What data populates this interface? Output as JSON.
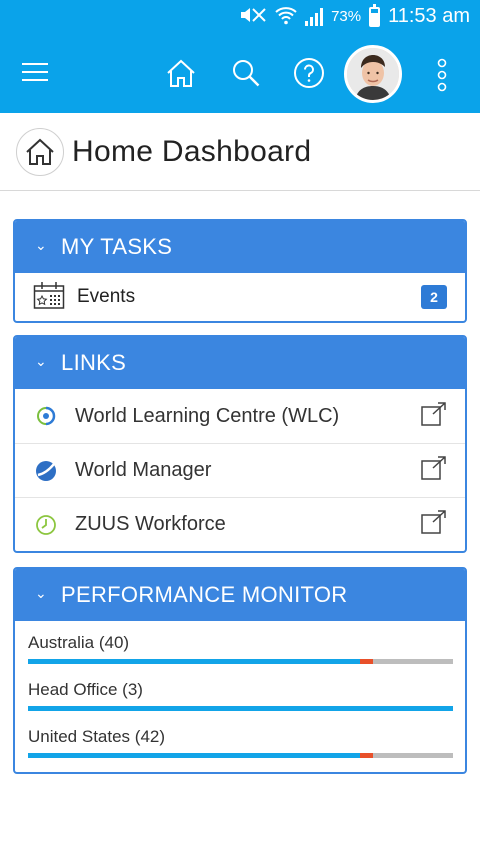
{
  "status_bar": {
    "battery": "73%",
    "time": "11:53 am"
  },
  "app_bar": {
    "icons": [
      "hamburger-menu-icon",
      "home-icon",
      "search-icon",
      "help-icon",
      "more-vertical-icon"
    ],
    "accent_color": "#0aa3ea"
  },
  "page": {
    "title": "Home Dashboard"
  },
  "my_tasks": {
    "header": "MY TASKS",
    "items": [
      {
        "label": "Events",
        "count": "2"
      }
    ]
  },
  "links": {
    "header": "LINKS",
    "items": [
      {
        "label": "World Learning Centre (WLC)",
        "icon": "wlc-logo-icon"
      },
      {
        "label": "World Manager",
        "icon": "world-manager-logo-icon"
      },
      {
        "label": "ZUUS Workforce",
        "icon": "zuus-clock-icon"
      }
    ]
  },
  "performance": {
    "header": "PERFORMANCE MONITOR",
    "items": [
      {
        "label": "Australia (40)",
        "progress": 0.78,
        "marker_width": 0.03
      },
      {
        "label": "Head Office (3)",
        "progress": 1.0,
        "marker_width": 0
      },
      {
        "label": "United States (42)",
        "progress": 0.78,
        "marker_width": 0.03
      }
    ],
    "colors": {
      "fill": "#12a4e8",
      "marker": "#e8502a",
      "track": "#bdbdbd"
    }
  },
  "card_color": "#3b86e0"
}
